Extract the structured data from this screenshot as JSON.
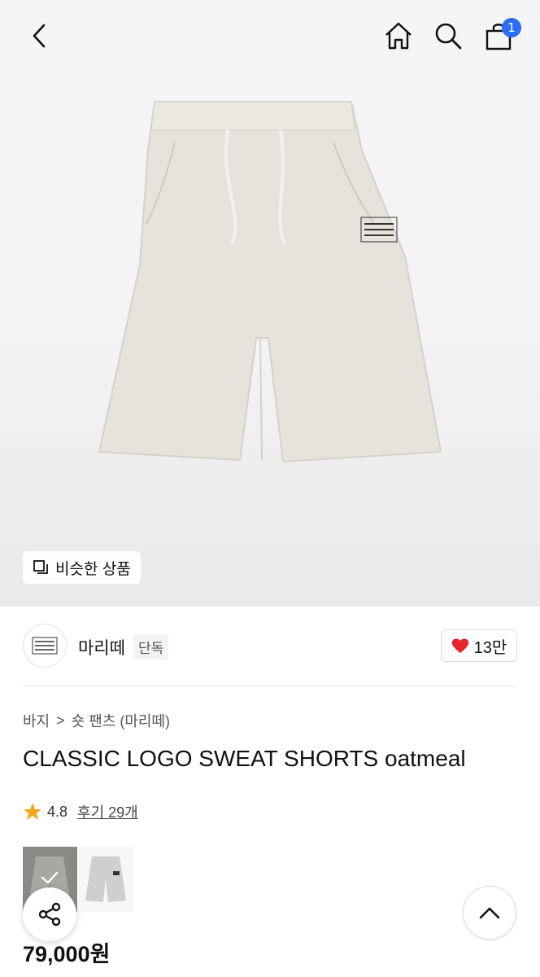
{
  "header": {
    "back_icon": "chevron-left-icon",
    "home_icon": "home-icon",
    "search_icon": "search-icon",
    "cart_icon": "shopping-bag-icon",
    "cart_count": "1",
    "badge_color": "#2c6cf6"
  },
  "hero": {
    "similar_label": "비슷한 상품",
    "similar_icon": "similar-items-icon"
  },
  "brand": {
    "name": "마리떼",
    "tag": "단독",
    "like_count": "13만",
    "heart_color": "#e8232d"
  },
  "product": {
    "breadcrumb": [
      "바지",
      "숏 팬츠 (마리떼)"
    ],
    "breadcrumb_separator": ">",
    "title": "CLASSIC LOGO SWEAT SHORTS oatmeal",
    "rating": "4.8",
    "review_link": "후기 29개",
    "star_color": "#f5a623",
    "price": "79,000원"
  },
  "swatches": [
    {
      "name": "oatmeal",
      "selected": true
    },
    {
      "name": "gray",
      "selected": false
    }
  ],
  "floating": {
    "share_icon": "share-icon",
    "scroll_top_icon": "chevron-up-icon"
  }
}
